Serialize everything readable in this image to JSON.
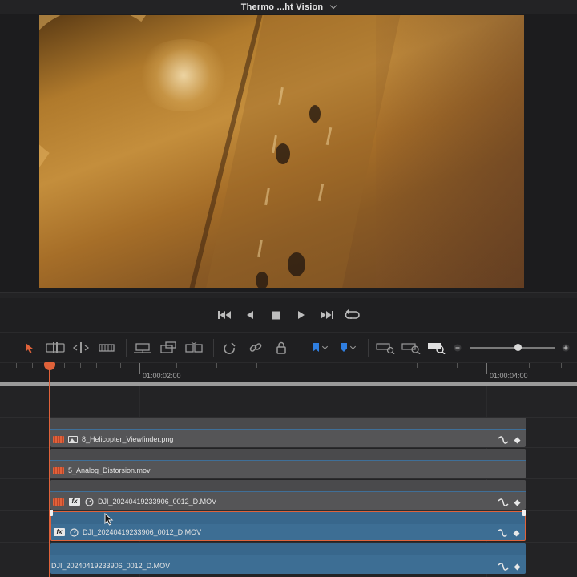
{
  "window": {
    "title": "Thermo  ...ht Vision"
  },
  "viewer": {
    "content": "Aerial night street footage with orange thermal tint"
  },
  "transport": {
    "buttons": [
      {
        "name": "go-to-start-button",
        "icon": "skip-start-icon"
      },
      {
        "name": "play-reverse-button",
        "icon": "play-reverse-icon"
      },
      {
        "name": "stop-button",
        "icon": "stop-icon"
      },
      {
        "name": "play-button",
        "icon": "play-icon"
      },
      {
        "name": "go-to-end-button",
        "icon": "skip-end-icon"
      },
      {
        "name": "loop-button",
        "icon": "loop-icon"
      }
    ]
  },
  "timeline": {
    "ruler": {
      "tc1": "01:00:02:00",
      "tc2": "01:00:04:00"
    },
    "clips": [
      {
        "name": "8_Helicopter_Viewfinder.png"
      },
      {
        "name": "5_Analog_Distorsion.mov"
      },
      {
        "name": "DJI_20240419233906_0012_D.MOV"
      },
      {
        "name": "DJI_20240419233906_0012_D.MOV"
      },
      {
        "name": "DJI_20240419233906_0012_D.MOV"
      }
    ]
  },
  "colors": {
    "accent": "#e0623a",
    "clip_blue": "#3d6e94",
    "clip_gray": "#555557",
    "flag_blue": "#2f7ee0"
  }
}
